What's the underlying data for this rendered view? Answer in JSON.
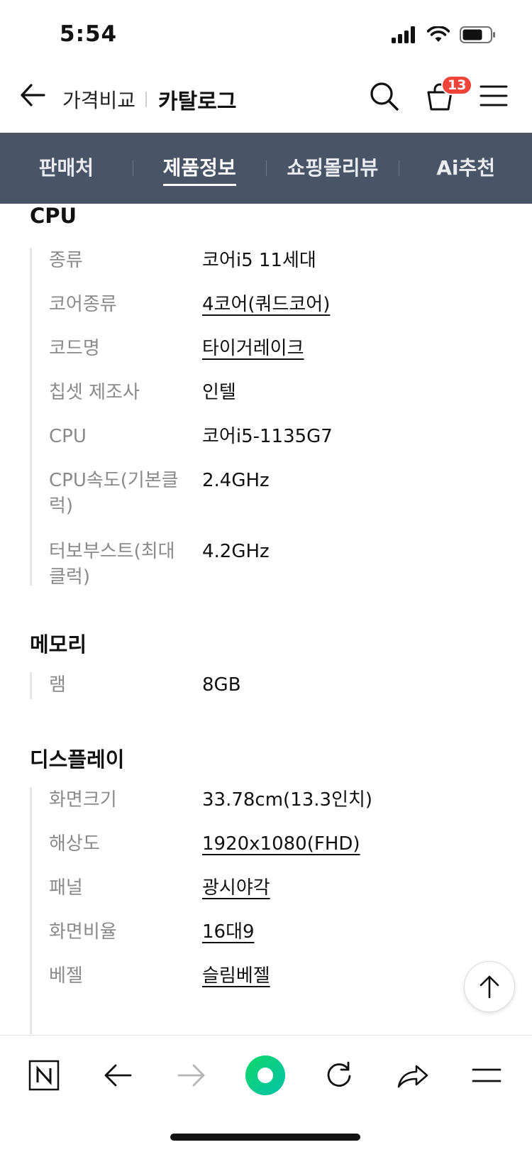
{
  "status_bar": {
    "time": "5:54"
  },
  "header": {
    "brand_sub": "가격비교",
    "brand_main": "카탈로그",
    "cart_count": "13"
  },
  "tabs": [
    {
      "label": "판매처",
      "active": false
    },
    {
      "label": "제품정보",
      "active": true
    },
    {
      "label": "쇼핑몰리뷰",
      "active": false
    },
    {
      "label": "Ai추천",
      "active": false
    }
  ],
  "sections": {
    "cpu": {
      "title": "CPU",
      "rows": [
        {
          "key": "종류",
          "value": "코어i5 11세대"
        },
        {
          "key": "코어종류",
          "value": "4코어(쿼드코어)"
        },
        {
          "key": "코드명",
          "value": "타이거레이크"
        },
        {
          "key": "칩셋 제조사",
          "value": "인텔"
        },
        {
          "key": "CPU",
          "value": "코어i5-1135G7"
        },
        {
          "key": "CPU속도(기본클럭)",
          "value": "2.4GHz"
        },
        {
          "key": "터보부스트(최대클럭)",
          "value": "4.2GHz"
        }
      ]
    },
    "memory": {
      "title": "메모리",
      "rows": [
        {
          "key": "램",
          "value": "8GB"
        }
      ]
    },
    "display": {
      "title": "디스플레이",
      "rows": [
        {
          "key": "화면크기",
          "value": "33.78cm(13.3인치)"
        },
        {
          "key": "해상도",
          "value": "1920x1080(FHD)"
        },
        {
          "key": "패널",
          "value": "광시야각"
        },
        {
          "key": "화면비율",
          "value": "16대9"
        },
        {
          "key": "베젤",
          "value": "슬림베젤"
        }
      ]
    }
  },
  "colors": {
    "tabbar_bg": "#4a5467",
    "badge": "#f0433a",
    "browser_accent": "#03c75a"
  }
}
